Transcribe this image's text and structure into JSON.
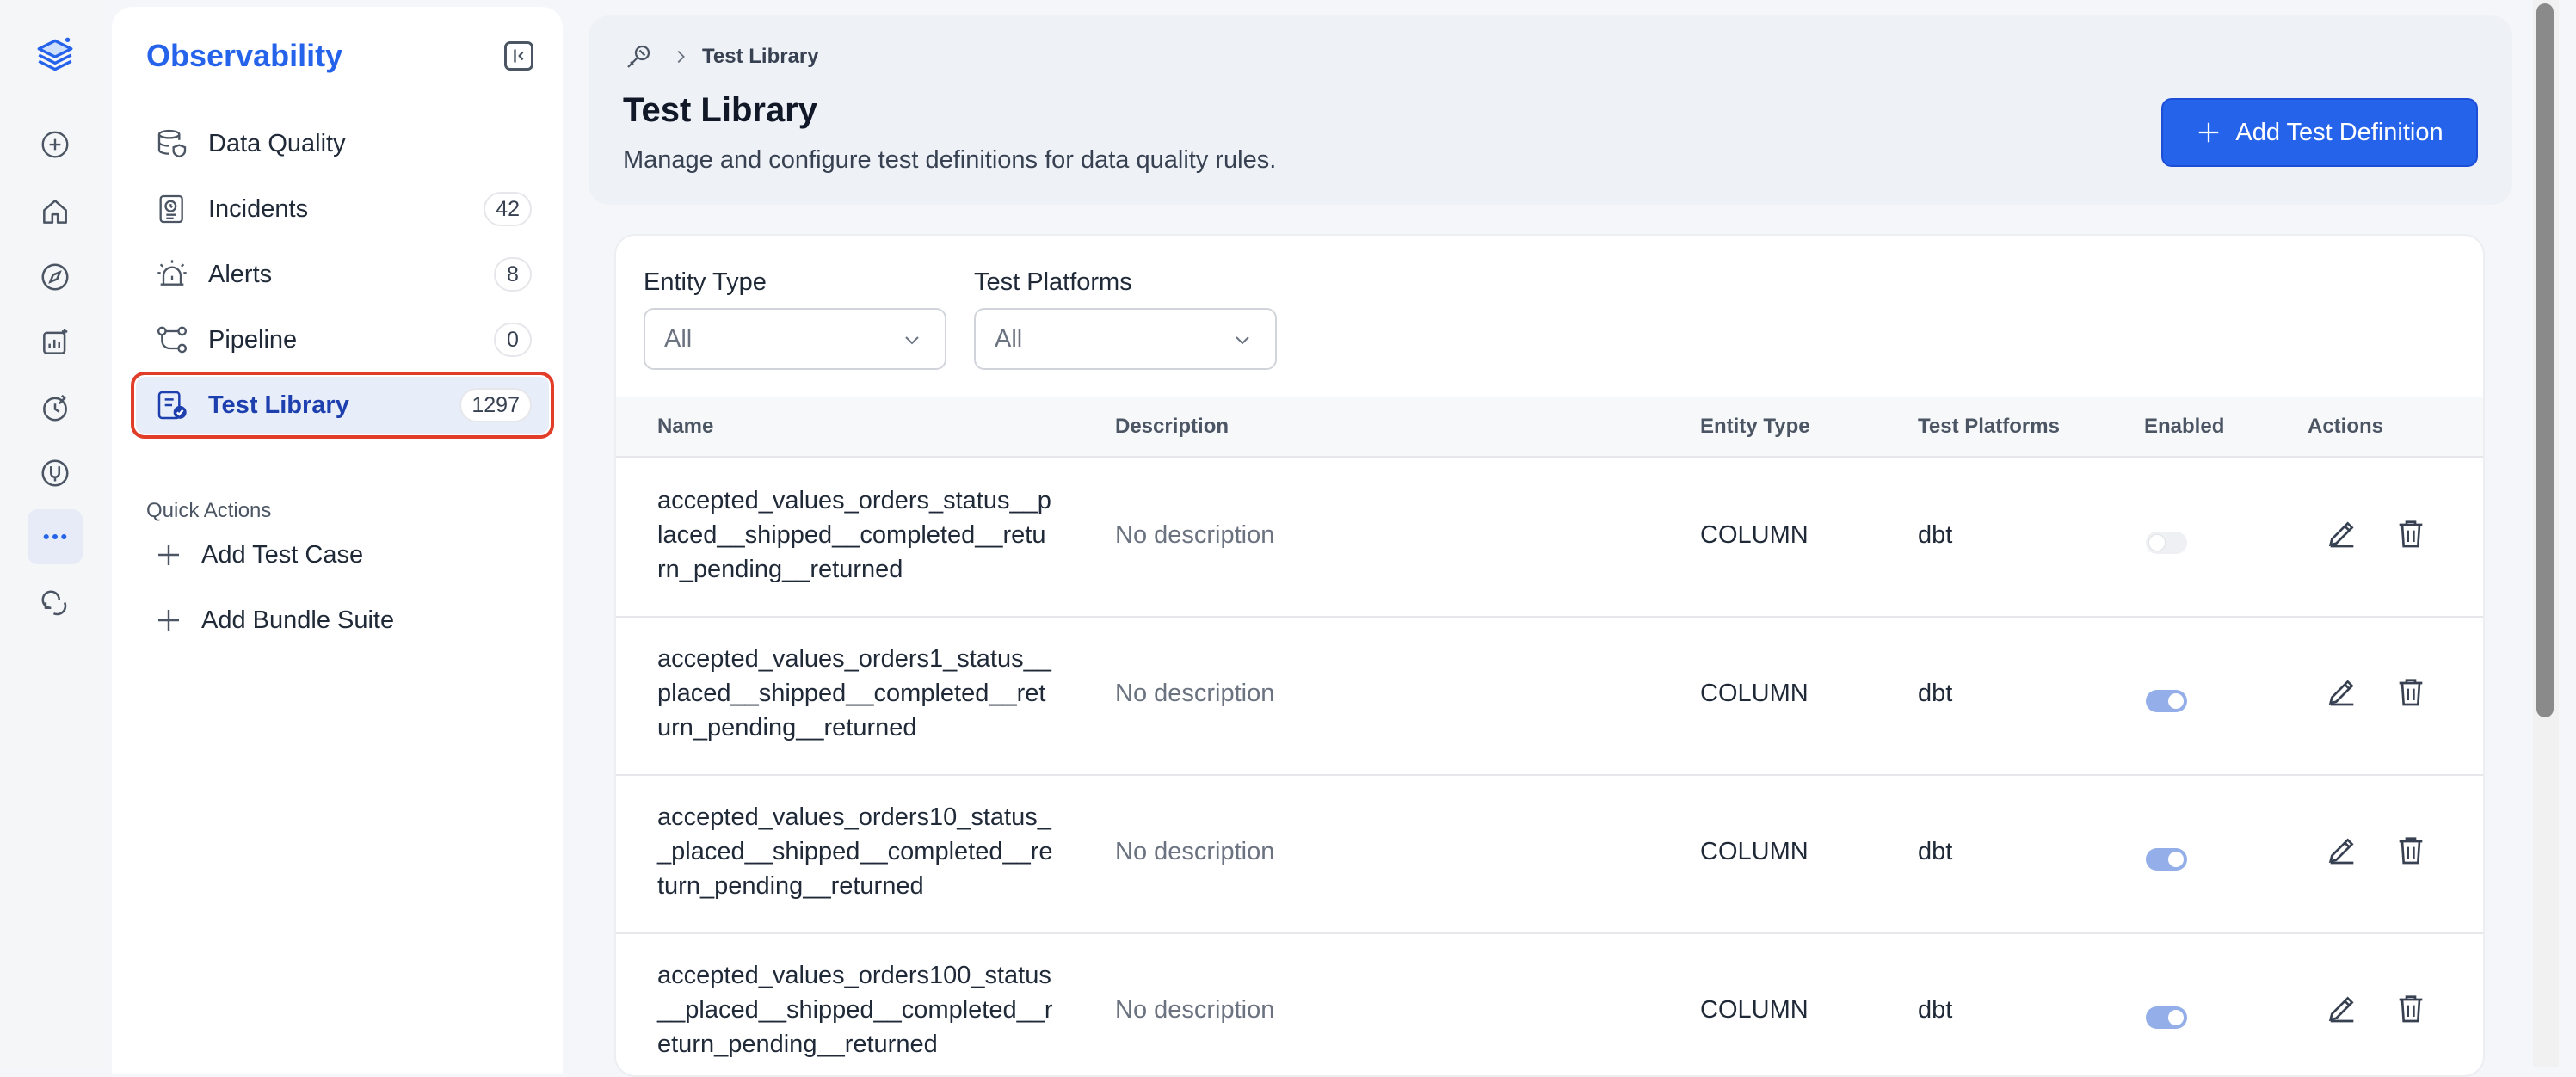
{
  "rail": {
    "icons": [
      "logo-icon",
      "plus-icon",
      "home-icon",
      "compass-icon",
      "insights-icon",
      "governance-icon",
      "observability-icon",
      "more-icon",
      "support-icon"
    ]
  },
  "sidebar": {
    "title": "Observability",
    "items": [
      {
        "label": "Data Quality",
        "badge": null,
        "icon": "database-shield-icon"
      },
      {
        "label": "Incidents",
        "badge": "42",
        "icon": "incident-icon"
      },
      {
        "label": "Alerts",
        "badge": "8",
        "icon": "siren-icon"
      },
      {
        "label": "Pipeline",
        "badge": "0",
        "icon": "pipeline-icon"
      },
      {
        "label": "Test Library",
        "badge": "1297",
        "icon": "test-library-icon"
      }
    ],
    "quick_actions_label": "Quick Actions",
    "quick_actions": [
      {
        "label": "Add Test Case"
      },
      {
        "label": "Add Bundle Suite"
      }
    ]
  },
  "header": {
    "breadcrumb": "Test Library",
    "title": "Test Library",
    "subtitle": "Manage and configure test definitions for data quality rules.",
    "add_button": "Add Test Definition"
  },
  "filters": {
    "entity_type": {
      "label": "Entity Type",
      "value": "All"
    },
    "test_platforms": {
      "label": "Test Platforms",
      "value": "All"
    }
  },
  "table": {
    "columns": [
      "Name",
      "Description",
      "Entity Type",
      "Test Platforms",
      "Enabled",
      "Actions"
    ],
    "rows": [
      {
        "name": "accepted_values_orders_status__placed__shipped__completed__return_pending__returned",
        "description": "No description",
        "entity_type": "COLUMN",
        "platform": "dbt",
        "enabled": false
      },
      {
        "name": "accepted_values_orders1_status__placed__shipped__completed__return_pending__returned",
        "description": "No description",
        "entity_type": "COLUMN",
        "platform": "dbt",
        "enabled": true
      },
      {
        "name": "accepted_values_orders10_status__placed__shipped__completed__return_pending__returned",
        "description": "No description",
        "entity_type": "COLUMN",
        "platform": "dbt",
        "enabled": true
      },
      {
        "name": "accepted_values_orders100_status__placed__shipped__completed__return_pending__returned",
        "description": "No description",
        "entity_type": "COLUMN",
        "platform": "dbt",
        "enabled": true
      }
    ]
  },
  "colors": {
    "accent": "#2563eb",
    "highlight_outline": "#e23d28",
    "toggle_on": "#93aee8"
  }
}
